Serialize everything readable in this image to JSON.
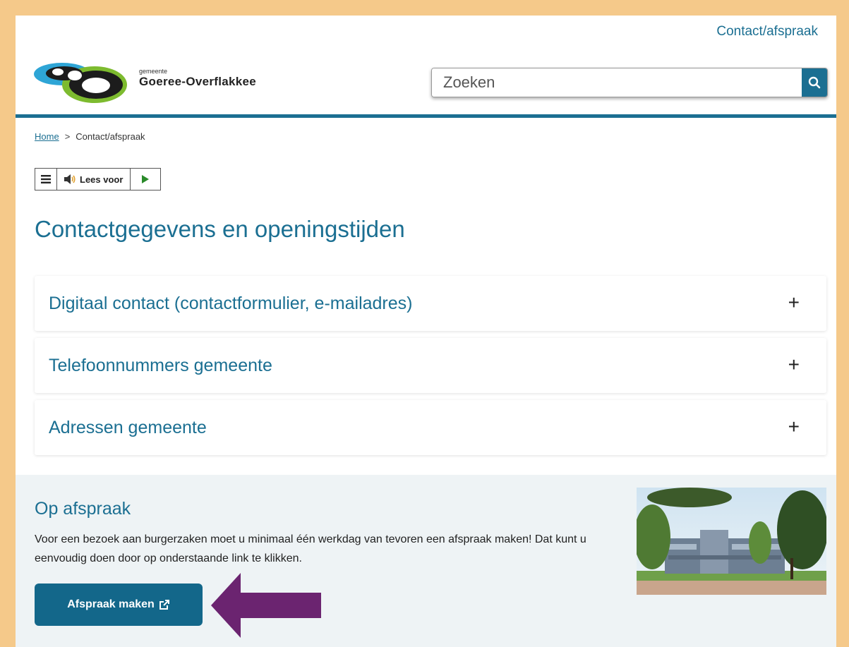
{
  "header": {
    "top_link": "Contact/afspraak",
    "logo_small": "gemeente",
    "logo_big": "Goeree-Overflakkee",
    "search_placeholder": "Zoeken"
  },
  "breadcrumb": {
    "home": "Home",
    "separator": ">",
    "current": "Contact/afspraak"
  },
  "readspeaker": {
    "label": "Lees voor"
  },
  "main": {
    "title": "Contactgegevens en openingstijden",
    "accordion": [
      {
        "title": "Digitaal contact (contactformulier, e-mailadres)",
        "icon": "+"
      },
      {
        "title": "Telefoonnummers gemeente",
        "icon": "+"
      },
      {
        "title": "Adressen gemeente",
        "icon": "+"
      }
    ]
  },
  "appointment": {
    "title": "Op afspraak",
    "text": "Voor een bezoek aan burgerzaken moet u minimaal één werkdag van tevoren een afspraak maken!  Dat kunt u eenvoudig doen door op onderstaande link te klikken.",
    "button_label": "Afspraak maken"
  },
  "colors": {
    "brand": "#1b6f92",
    "frame": "#f5c98a",
    "arrow": "#6b2470",
    "section_bg": "#eef3f5"
  },
  "icons": [
    "search-icon",
    "menu-icon",
    "speaker-icon",
    "play-icon",
    "plus-icon",
    "external-link-icon",
    "arrow-left-icon"
  ]
}
